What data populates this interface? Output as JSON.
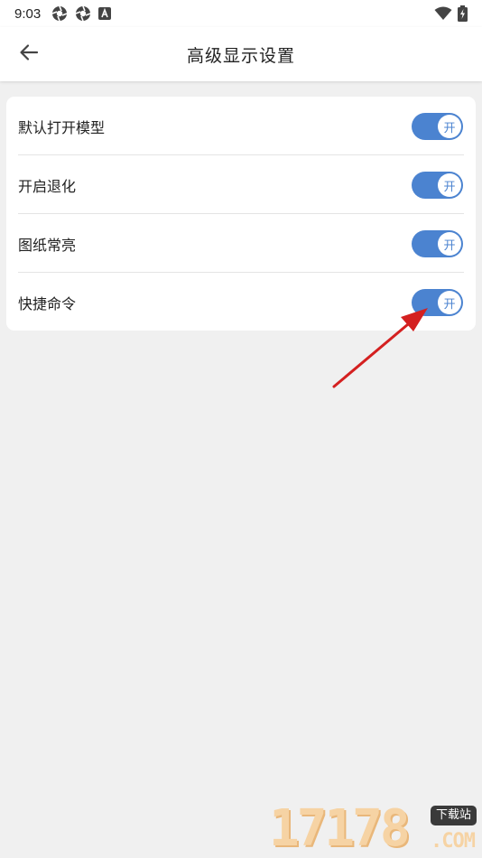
{
  "status_bar": {
    "time": "9:03",
    "left_icons": [
      "aperture-icon",
      "aperture-icon",
      "a-badge-icon"
    ],
    "right_icons": [
      "wifi-icon",
      "battery-charging-icon"
    ]
  },
  "header": {
    "title": "高级显示设置",
    "back_icon": "arrow-left-icon"
  },
  "settings": [
    {
      "label": "默认打开模型",
      "toggle_text": "开",
      "on": true
    },
    {
      "label": "开启退化",
      "toggle_text": "开",
      "on": true
    },
    {
      "label": "图纸常亮",
      "toggle_text": "开",
      "on": true
    },
    {
      "label": "快捷命令",
      "toggle_text": "开",
      "on": true
    }
  ],
  "colors": {
    "toggle_on": "#4b83d0",
    "background": "#f0f0f0",
    "annotation_arrow": "#d42020"
  },
  "watermark": {
    "digits": "17178",
    "badge": "下载站",
    "suffix": ".COM"
  }
}
